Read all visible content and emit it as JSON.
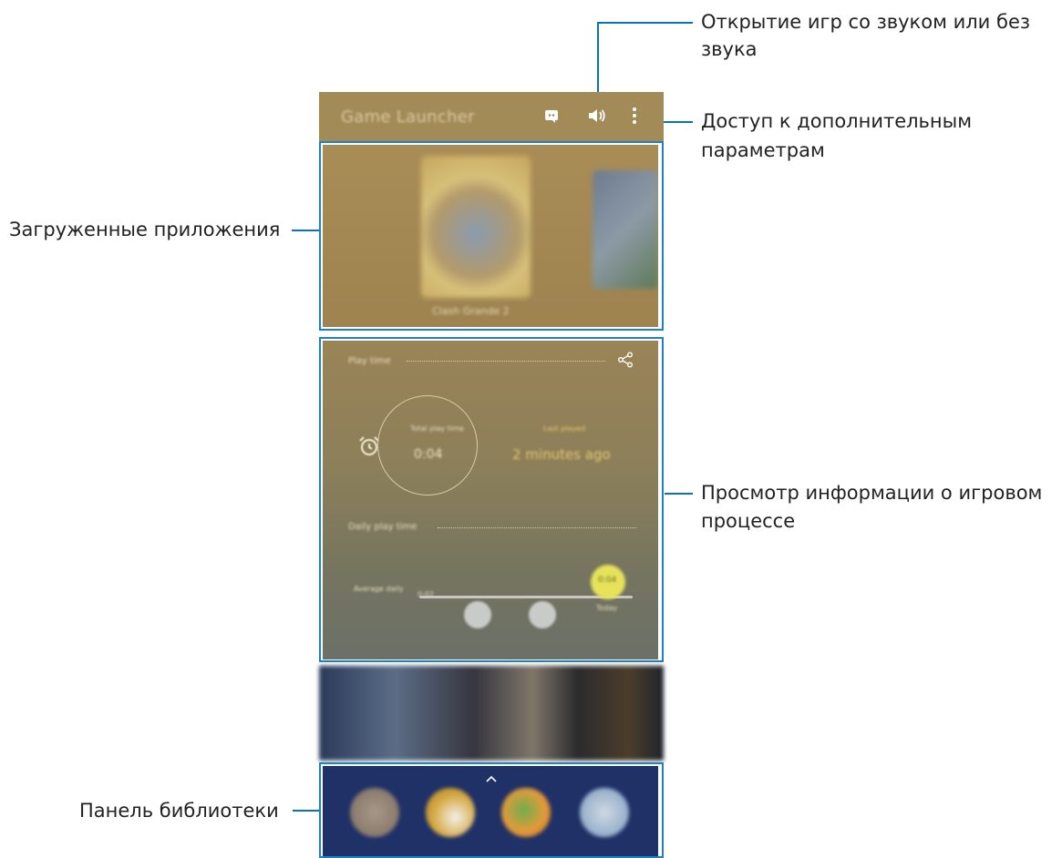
{
  "app": {
    "title": "Game Launcher",
    "colors": {
      "appbar": "#a38b58",
      "callout_line": "#0a73b3",
      "library_panel": "#1f3167"
    }
  },
  "toolbar": {
    "icons": [
      "discord-icon",
      "volume-icon",
      "more-options-icon"
    ]
  },
  "callouts": {
    "sound_line1": "Открытие игр со звуком или без",
    "sound_line2": "звука",
    "options_line1": "Доступ к дополнительным",
    "options_line2": "параметрам",
    "installed_apps": "Загруженные приложения",
    "info_line1": "Просмотр информации о игровом",
    "info_line2": "процессе",
    "library_panel": "Панель библиотеки"
  },
  "games": {
    "featured_label": "Clash Grande 2"
  },
  "stats": {
    "play_time_label": "Play time",
    "today_label": "Total play time",
    "today_value": "0:04",
    "last_played_label": "Last played",
    "last_played_value": "2 minutes ago",
    "daily_label": "Daily play time",
    "avg_label": "Average daily",
    "avg_value": "0:02",
    "today_bubble": "0:04",
    "today_caption": "Today"
  },
  "library": {
    "expand_icon": "chevron-up-icon"
  }
}
